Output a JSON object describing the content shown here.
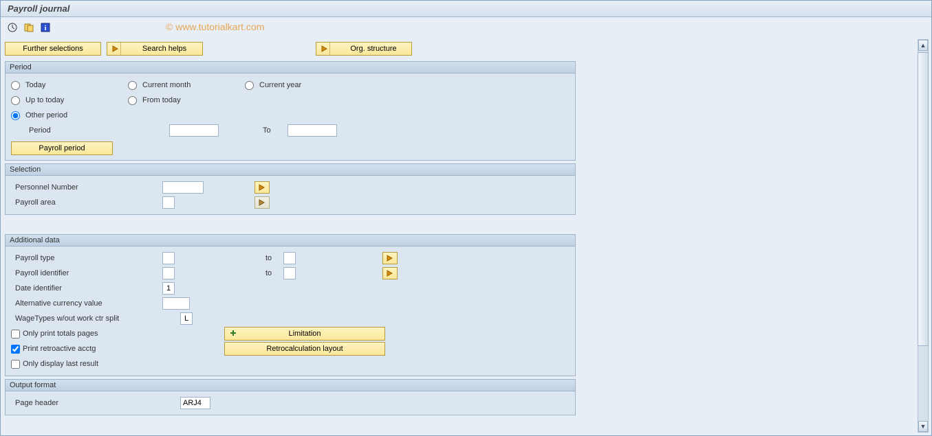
{
  "title": "Payroll journal",
  "watermark": "© www.tutorialkart.com",
  "buttons": {
    "further_selections": "Further selections",
    "search_helps": "Search helps",
    "org_structure": "Org. structure",
    "payroll_period": "Payroll period",
    "limitation": "Limitation",
    "retrocalc_layout": "Retrocalculation layout"
  },
  "groups": {
    "period": {
      "title": "Period",
      "today": "Today",
      "current_month": "Current month",
      "current_year": "Current year",
      "up_to_today": "Up to today",
      "from_today": "From today",
      "other_period": "Other period",
      "period_label": "Period",
      "to_label": "To",
      "period_from": "",
      "period_to": ""
    },
    "selection": {
      "title": "Selection",
      "personnel_number": "Personnel Number",
      "personnel_number_val": "",
      "payroll_area": "Payroll area",
      "payroll_area_val": ""
    },
    "additional_data": {
      "title": "Additional data",
      "payroll_type": "Payroll type",
      "payroll_type_from": "",
      "payroll_type_to_label": "to",
      "payroll_type_to": "",
      "payroll_identifier": "Payroll identifier",
      "payroll_identifier_from": "",
      "payroll_identifier_to_label": "to",
      "payroll_identifier_to": "",
      "date_identifier": "Date identifier",
      "date_identifier_val": "1",
      "alt_currency": "Alternative currency value",
      "alt_currency_val": "",
      "wagetypes": "WageTypes w/out work ctr split",
      "wagetypes_val": "L",
      "only_totals": "Only print totals pages",
      "print_retro": "Print retroactive acctg",
      "only_last": "Only display last result"
    },
    "output_format": {
      "title": "Output format",
      "page_header": "Page header",
      "page_header_val": "ARJ4"
    }
  }
}
